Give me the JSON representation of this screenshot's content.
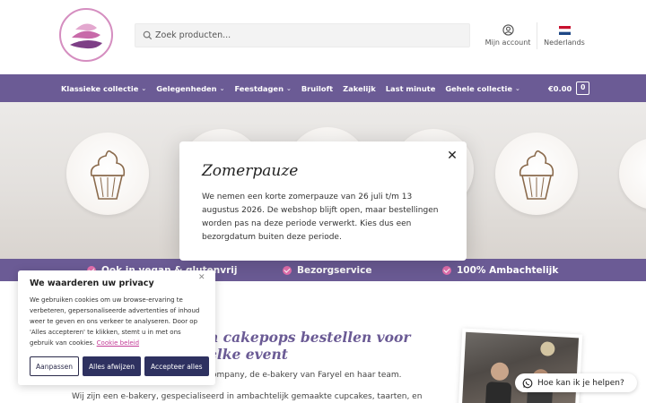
{
  "header": {
    "logo_icon": "cupcake-swirl-logo",
    "search": {
      "placeholder": "Zoek producten..."
    },
    "account_label": "Mijn account",
    "language_label": "Nederlands"
  },
  "nav": {
    "items": [
      {
        "label": "Klassieke collectie",
        "has_dropdown": true
      },
      {
        "label": "Gelegenheden",
        "has_dropdown": true
      },
      {
        "label": "Feestdagen",
        "has_dropdown": true
      },
      {
        "label": "Bruiloft",
        "has_dropdown": false
      },
      {
        "label": "Zakelijk",
        "has_dropdown": false
      },
      {
        "label": "Last minute",
        "has_dropdown": false
      },
      {
        "label": "Gehele collectie",
        "has_dropdown": true
      }
    ],
    "cart_total": "€0.00",
    "cart_count": "0"
  },
  "features": [
    "Ook in vegan & glutenvrij",
    "Bezorgservice",
    "100% Ambachtelijk"
  ],
  "main": {
    "heading": "n cakepops bestellen voor elke event",
    "intro_line1": "ompany, de e-bakery van Faryel en haar team.",
    "intro_line2": "Wij zijn een e-bakery, gespecialiseerd in ambachtelijk gemaakte cupcakes, taarten, en"
  },
  "modal": {
    "title": "Zomerpauze",
    "body": "We nemen een korte zomerpauze van 26 juli t/m 13 augustus 2026. De webshop blijft open, maar bestellingen worden pas na deze periode verwerkt. Kies dus een bezorgdatum buiten deze periode."
  },
  "cookie": {
    "title": "We waarderen uw privacy",
    "text": "We gebruiken cookies om uw browse-ervaring te verbeteren, gepersonaliseerde advertenties of inhoud weer te geven en ons verkeer te analyseren. Door op 'Alles accepteren' te klikken, stemt u in met ons gebruik van cookies.",
    "link": "Cookie beleid",
    "buttons": {
      "customize": "Aanpassen",
      "reject": "Alles afwijzen",
      "accept": "Accepteer alles"
    }
  },
  "help_widget": {
    "label": "Hoe kan ik je helpen?",
    "icon": "whatsapp-icon"
  },
  "colors": {
    "brand_purple": "#6b5b95",
    "accent_pink": "#e46fae",
    "button_navy": "#2e3160"
  }
}
